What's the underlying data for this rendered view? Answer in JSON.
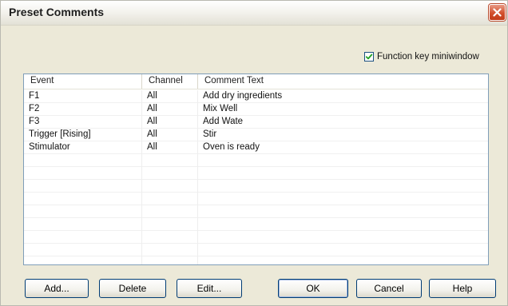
{
  "window": {
    "title": "Preset Comments"
  },
  "options": {
    "function_key_label": "Function key miniwindow",
    "function_key_checked": true
  },
  "table": {
    "columns": [
      "Event",
      "Channel",
      "Comment Text"
    ],
    "rows": [
      {
        "event": "F1",
        "channel": "All",
        "comment": "Add dry ingredients"
      },
      {
        "event": "F2",
        "channel": "All",
        "comment": "Mix Well"
      },
      {
        "event": "F3",
        "channel": "All",
        "comment": "Add Wate"
      },
      {
        "event": "Trigger [Rising]",
        "channel": "All",
        "comment": "Stir"
      },
      {
        "event": "Stimulator",
        "channel": "All",
        "comment": "Oven is ready"
      },
      {
        "event": "",
        "channel": "",
        "comment": ""
      },
      {
        "event": "",
        "channel": "",
        "comment": ""
      },
      {
        "event": "",
        "channel": "",
        "comment": ""
      },
      {
        "event": "",
        "channel": "",
        "comment": ""
      },
      {
        "event": "",
        "channel": "",
        "comment": ""
      },
      {
        "event": "",
        "channel": "",
        "comment": ""
      },
      {
        "event": "",
        "channel": "",
        "comment": ""
      },
      {
        "event": "",
        "channel": "",
        "comment": ""
      },
      {
        "event": "",
        "channel": "",
        "comment": ""
      }
    ]
  },
  "buttons": {
    "add": "Add...",
    "delete": "Delete",
    "edit": "Edit...",
    "ok": "OK",
    "cancel": "Cancel",
    "help": "Help"
  },
  "icons": {
    "close": "close-icon",
    "check": "check-icon"
  },
  "colors": {
    "close_button": "#d2502d",
    "check": "#21a121",
    "list_border": "#7f9db9"
  }
}
